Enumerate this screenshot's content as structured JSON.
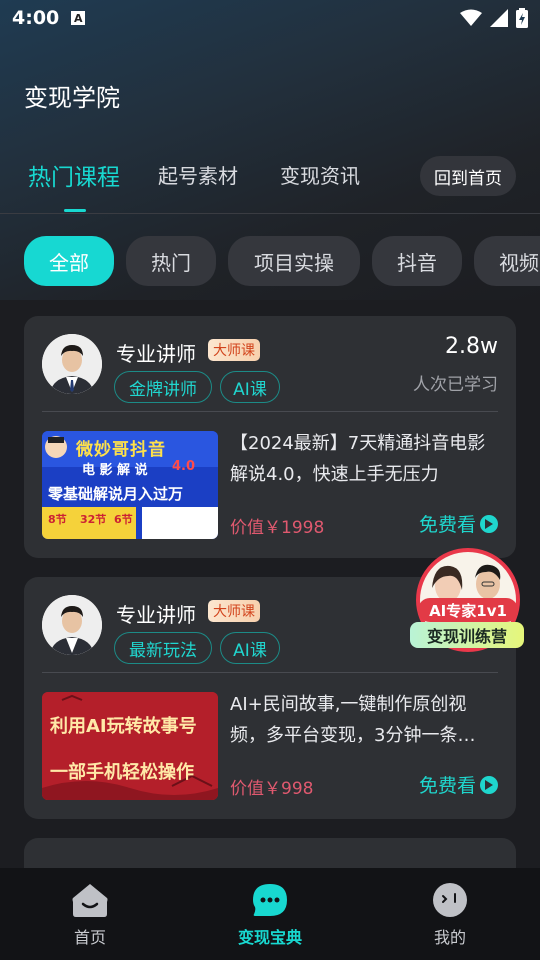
{
  "status": {
    "time": "4:00",
    "a_icon_label": "A"
  },
  "header": {
    "title": "变现学院"
  },
  "tabs": [
    {
      "label": "热门课程",
      "active": true
    },
    {
      "label": "起号素材",
      "active": false
    },
    {
      "label": "变现资讯",
      "active": false
    }
  ],
  "home_button": "回到首页",
  "chips": [
    "全部",
    "热门",
    "项目实操",
    "抖音",
    "视频"
  ],
  "cards": [
    {
      "teacher": "专业讲师",
      "badge": "大师课",
      "tags": [
        "金牌讲师",
        "AI课"
      ],
      "count": "2.8w",
      "count_label": "人次已学习",
      "title": "【2024最新】7天精通抖音电影解说4.0，快速上手无压力",
      "price": "价值￥1998",
      "action": "免费看",
      "thumb": {
        "line1": "微妙哥抖音",
        "line2": "电 影 解 说",
        "version": "4.0",
        "line3": "零基础解说月入过万",
        "stats": [
          "8节",
          "32节",
          "6节"
        ]
      }
    },
    {
      "teacher": "专业讲师",
      "badge": "大师课",
      "tags": [
        "最新玩法",
        "AI课"
      ],
      "count": "",
      "count_label": "",
      "title": "AI+民间故事,一键制作原创视频，多平台变现，3分钟一条…",
      "price": "价值￥998",
      "action": "免费看",
      "thumb": {
        "line1": "利用AI玩转故事号",
        "line2": "一部手机轻松操作"
      }
    }
  ],
  "floating_promo": {
    "line1": "AI专家1v1",
    "line2": "变现训练营"
  },
  "bottom_nav": [
    {
      "label": "首页",
      "icon": "home-icon",
      "active": false
    },
    {
      "label": "变现宝典",
      "icon": "chat-bubble-icon",
      "active": true
    },
    {
      "label": "我的",
      "icon": "profile-face-icon",
      "active": false
    }
  ],
  "colors": {
    "accent": "#18d8d0",
    "price": "#e0596f",
    "card_bg": "#2e3034",
    "page_bg": "#1c1d21"
  }
}
